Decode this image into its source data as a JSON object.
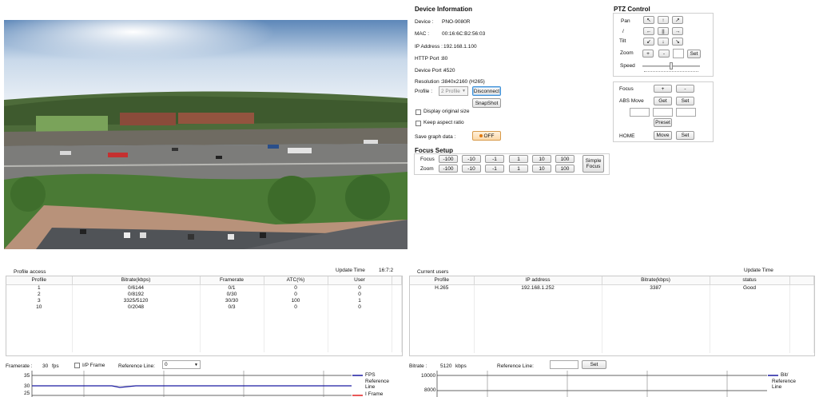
{
  "device_info": {
    "title": "Device Information",
    "device_label": "Device :",
    "device_value": "PNO-9080R",
    "mac_label": "MAC :",
    "mac_value": "00:16:6C:B2:56:03",
    "ip_label": "IP Address :",
    "ip_value": "192.168.1.100",
    "http_label": "HTTP Port :",
    "http_value": "80",
    "devport_label": "Device Port :",
    "devport_value": "4520",
    "res_label": "Resolution :",
    "res_value": "3840x2160 (H265)",
    "profile_label": "Profile :",
    "profile_value": "2 Profile",
    "disconnect_label": "Disconnect",
    "snapshot_label": "SnapShot",
    "display_original_label": "Display original size",
    "keep_aspect_label": "Keep aspect ratio",
    "save_graph_label": "Save graph data :",
    "save_graph_toggle": "OFF"
  },
  "ptz": {
    "title": "PTZ Control",
    "pan_label": "Pan",
    "slash_label": "/",
    "tilt_label": "Tilt",
    "zoom_label": "Zoom",
    "speed_label": "Speed",
    "arrows": [
      "↖",
      "↑",
      "↗",
      "←",
      "||",
      "→",
      "↙",
      "↓",
      "↘"
    ],
    "zoom_in": "+",
    "zoom_out": "-",
    "set_label": "Set",
    "focus_label": "Focus",
    "focus_plus": "+",
    "focus_minus": "-",
    "abs_move_label": "ABS Move",
    "get_label": "Get",
    "set2_label": "Set",
    "preset_label": "Preset",
    "home_label": "HOME",
    "move_label": "Move",
    "set3_label": "Set"
  },
  "focus_setup": {
    "title": "Focus Setup",
    "focus_label": "Focus",
    "zoom_label": "Zoom",
    "steps": [
      "-100",
      "-10",
      "-1",
      "1",
      "10",
      "100"
    ],
    "simple_focus_label": "Simple\nFocus"
  },
  "profile_access": {
    "title": "Profile access",
    "update_label": "Update Time",
    "update_value": "16:7:2",
    "columns": [
      "Profile",
      "Bitrate(kbps)",
      "Framerate",
      "ATC(%)",
      "User"
    ],
    "rows": [
      [
        "1",
        "0/6144",
        "0/1",
        "0",
        "0"
      ],
      [
        "2",
        "0/8192",
        "0/30",
        "0",
        "0"
      ],
      [
        "3",
        "3325/5120",
        "30/30",
        "100",
        "1"
      ],
      [
        "10",
        "0/2048",
        "0/3",
        "0",
        "0"
      ]
    ]
  },
  "current_users": {
    "title": "Current users",
    "update_label": "Update Time",
    "columns": [
      "Profile",
      "IP address",
      "Bitrate(kbps)",
      "status"
    ],
    "rows": [
      [
        "H.265",
        "192.168.1.252",
        "3387",
        "Good"
      ]
    ]
  },
  "framerate_bar": {
    "label": "Framerate :",
    "value": "30",
    "unit": "fps",
    "ip_frame_label": "I/P Frame",
    "ref_line_label": "Reference Line:",
    "ref_line_value": "0"
  },
  "bitrate_bar": {
    "label": "Bitrate :",
    "value": "5120",
    "unit": "kbps",
    "ref_line_label": "Reference Line:",
    "set_label": "Set"
  },
  "fps_chart": {
    "y_ticks": [
      "35",
      "30",
      "25"
    ],
    "legend": [
      "FPS",
      "Reference\nLine",
      "I Frame"
    ],
    "colors": {
      "fps": "#1a1aa0",
      "reference": "#1a1aa0",
      "iframe": "#e02020"
    }
  },
  "bitrate_chart": {
    "y_ticks": [
      "10000",
      "8000"
    ],
    "legend": [
      "Bit/",
      "Reference\nLine"
    ],
    "colors": {
      "bitrate": "#1a1aa0"
    }
  }
}
